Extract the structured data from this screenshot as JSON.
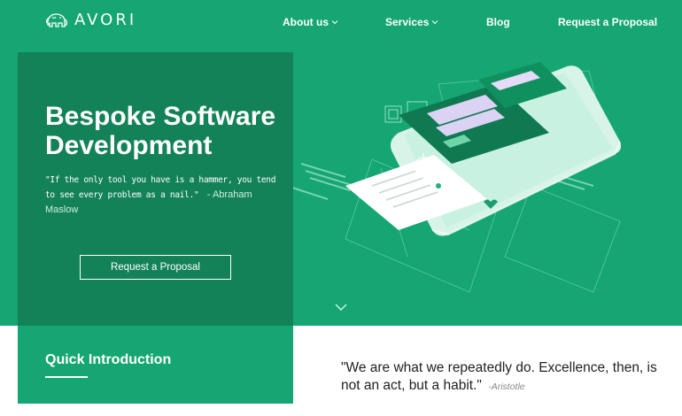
{
  "brand": {
    "name": "AVORI"
  },
  "nav": {
    "items": [
      {
        "label": "About us",
        "has_dropdown": true
      },
      {
        "label": "Services",
        "has_dropdown": true
      },
      {
        "label": "Blog",
        "has_dropdown": false
      },
      {
        "label": "Request a Proposal",
        "has_dropdown": false
      }
    ]
  },
  "hero": {
    "title": "Bespoke Software Development",
    "quote": "\"If the only tool you have is a hammer, you tend to see every problem as a nail.\"",
    "quote_author": "- Abraham Maslow",
    "cta_label": "Request a Proposal",
    "illustration": "isometric-phone-ui-wireframe",
    "scroll_icon": "chevron-down-icon"
  },
  "intro": {
    "title": "Quick Introduction",
    "quote": "\"We are what we repeatedly do. Excellence, then, is not an act, but a habit.\"",
    "quote_author": "-Aristotle"
  },
  "colors": {
    "brand_green": "#15a673",
    "panel_green": "#138259",
    "text_dark": "#222222",
    "text_muted": "#888888"
  }
}
